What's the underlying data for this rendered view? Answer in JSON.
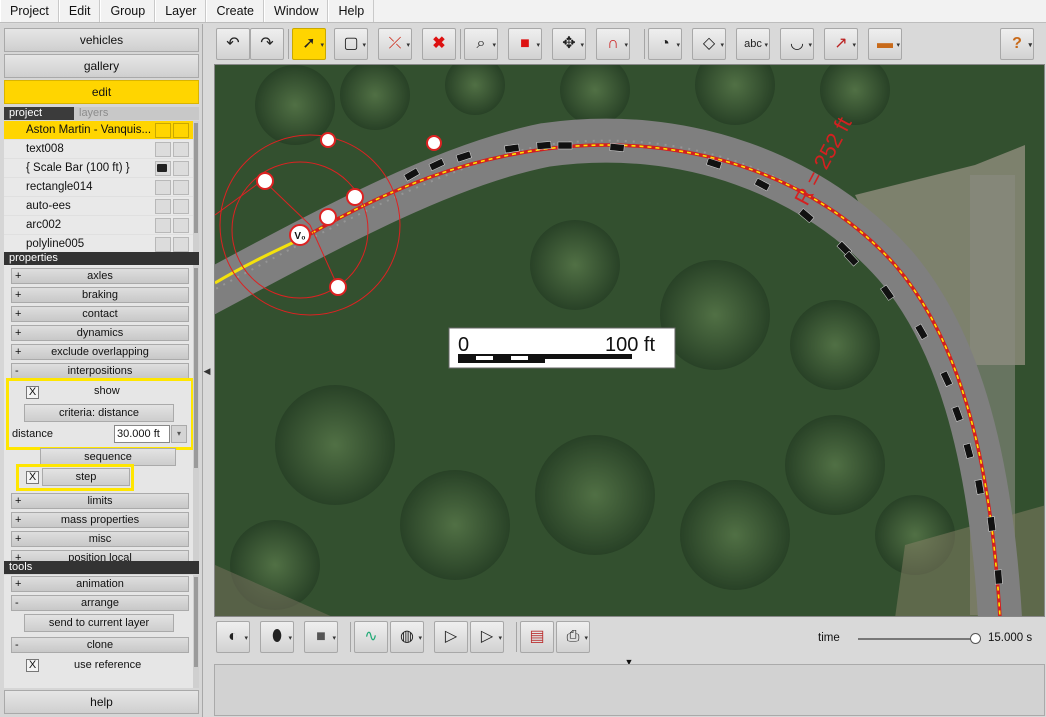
{
  "menu": [
    "Project",
    "Edit",
    "Group",
    "Layer",
    "Create",
    "Window",
    "Help"
  ],
  "nav": {
    "vehicles": "vehicles",
    "gallery": "gallery",
    "edit": "edit"
  },
  "tabs": {
    "project": "project",
    "layers": "layers"
  },
  "project_items": [
    {
      "label": "Aston Martin - Vanquis..."
    },
    {
      "label": "text008"
    },
    {
      "label": "{ Scale Bar (100 ft) }"
    },
    {
      "label": "rectangle014"
    },
    {
      "label": "auto-ees"
    },
    {
      "label": "arc002"
    },
    {
      "label": "polyline005"
    }
  ],
  "properties": {
    "heading": "properties",
    "groups": [
      {
        "sign": "+",
        "label": "axles"
      },
      {
        "sign": "+",
        "label": "braking"
      },
      {
        "sign": "+",
        "label": "contact"
      },
      {
        "sign": "+",
        "label": "dynamics"
      },
      {
        "sign": "+",
        "label": "exclude overlapping"
      },
      {
        "sign": "-",
        "label": "interpositions"
      }
    ],
    "show_label": "show",
    "show_mark": "X",
    "criteria_label": "criteria: distance",
    "distance_label": "distance",
    "distance_value": "30.000 ft",
    "sequence_label": "sequence",
    "step_label": "step",
    "step_mark": "X",
    "groups2": [
      {
        "sign": "+",
        "label": "limits"
      },
      {
        "sign": "+",
        "label": "mass properties"
      },
      {
        "sign": "+",
        "label": "misc"
      },
      {
        "sign": "+",
        "label": "position local"
      }
    ]
  },
  "tools": {
    "heading": "tools",
    "animation": {
      "sign": "+",
      "label": "animation"
    },
    "arrange": {
      "sign": "-",
      "label": "arrange"
    },
    "send_to_layer": "send to current layer",
    "clone": {
      "sign": "-",
      "label": "clone"
    },
    "use_reference": "use reference",
    "use_reference_mark": "X"
  },
  "help_label": "help",
  "toolbar_top": [
    {
      "name": "undo-icon",
      "glyph": "↶"
    },
    {
      "name": "redo-icon",
      "glyph": "↷"
    },
    {
      "name": "select-arrow-icon",
      "glyph": "➚"
    },
    {
      "name": "rectangle-select-icon",
      "glyph": "▢"
    },
    {
      "name": "delete-node-icon",
      "glyph": "⤫"
    },
    {
      "name": "delete-icon",
      "glyph": "✖"
    },
    {
      "name": "zoom-icon",
      "glyph": "🔍"
    },
    {
      "name": "cube-icon",
      "glyph": "■"
    },
    {
      "name": "pan-icon",
      "glyph": "✥"
    },
    {
      "name": "magnet-icon",
      "glyph": "∩"
    },
    {
      "name": "gauge-icon",
      "glyph": "◔"
    },
    {
      "name": "surface-icon",
      "glyph": "◇"
    },
    {
      "name": "text-tool-icon",
      "glyph": "abc"
    },
    {
      "name": "curve-tool-icon",
      "glyph": "◡"
    },
    {
      "name": "measure-tool-icon",
      "glyph": "↗"
    },
    {
      "name": "ruler-tool-icon",
      "glyph": "▬"
    },
    {
      "name": "help-icon",
      "glyph": "?"
    }
  ],
  "toolbar_bottom": [
    {
      "name": "shading-icon",
      "glyph": "◐"
    },
    {
      "name": "shape-icon",
      "glyph": "⬮"
    },
    {
      "name": "color-square-icon",
      "glyph": "■"
    },
    {
      "name": "graph-icon",
      "glyph": "∿"
    },
    {
      "name": "camera-icon",
      "glyph": "◍"
    },
    {
      "name": "play-icon",
      "glyph": "▷"
    },
    {
      "name": "play-options-icon",
      "glyph": "▷"
    },
    {
      "name": "report-icon",
      "glyph": "▤"
    },
    {
      "name": "print-icon",
      "glyph": "⎙"
    }
  ],
  "time": {
    "label": "time",
    "value": "15.000 s",
    "fraction": 1.0
  },
  "map": {
    "radius_label": "R = 252 ft",
    "scalebar_zero": "0",
    "scalebar_max": "100 ft",
    "v0_label": "V₀"
  },
  "colors": {
    "accent": "#ffd500",
    "path": "#d21f1f",
    "path_center": "#ffe600"
  }
}
